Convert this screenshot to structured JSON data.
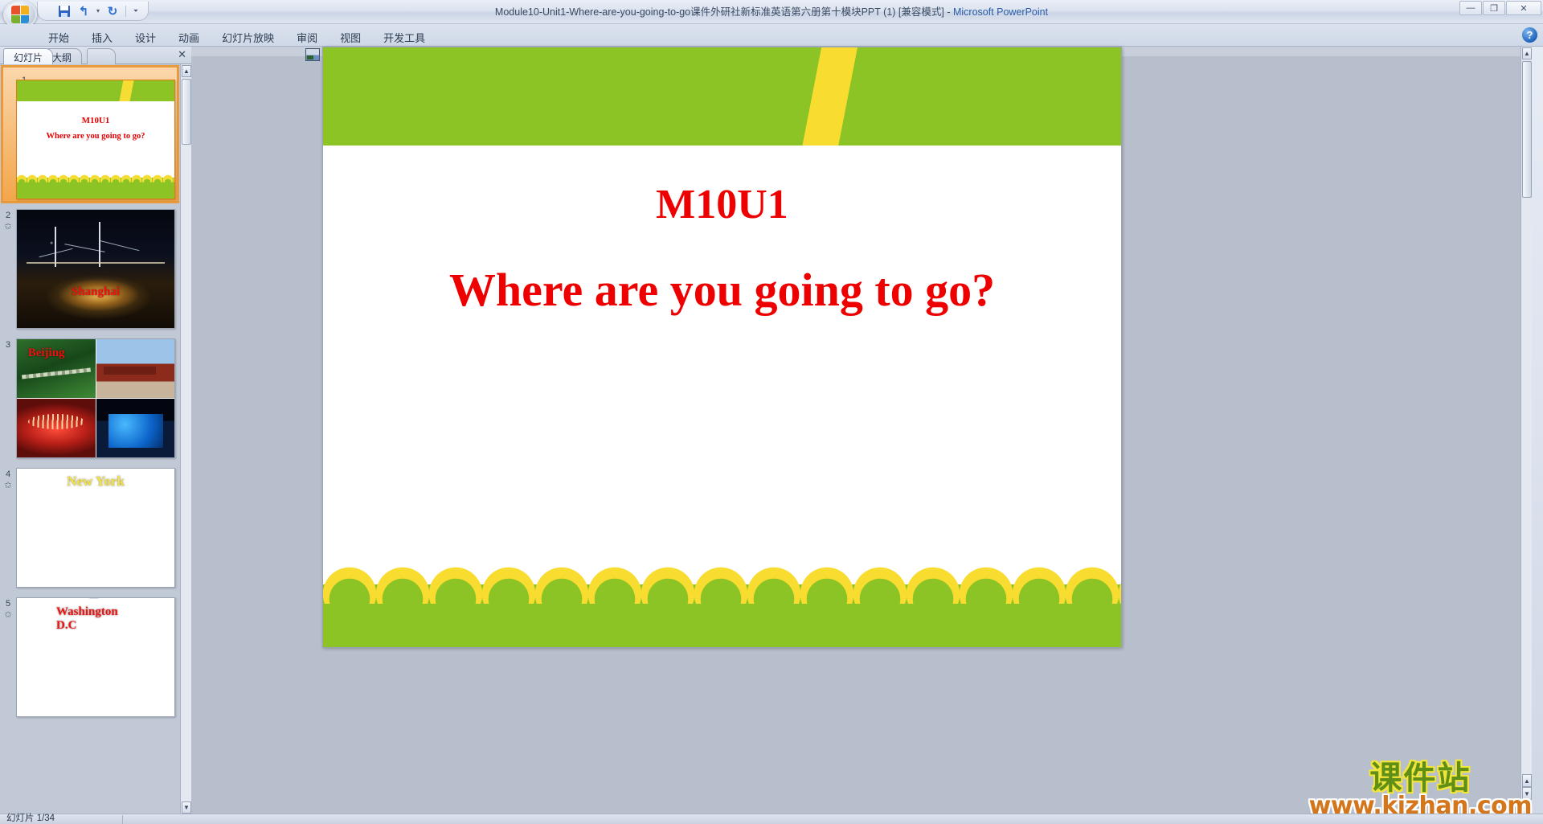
{
  "window": {
    "title": "Module10-Unit1-Where-are-you-going-to-go课件外研社新标准英语第六册第十模块PPT (1) [兼容模式]",
    "separator": " - ",
    "app_name": "Microsoft PowerPoint",
    "minimize_label": "—",
    "restore_label": "❐",
    "close_label": "✕"
  },
  "quick_access": {
    "save_label": "Save",
    "undo_label": "↰",
    "undo_caret": "▾",
    "redo_label": "↻",
    "customize_label": "⏷"
  },
  "office_button": {
    "label": "Office"
  },
  "ribbon": {
    "tabs": [
      {
        "label": "开始"
      },
      {
        "label": "插入"
      },
      {
        "label": "设计"
      },
      {
        "label": "动画"
      },
      {
        "label": "幻灯片放映"
      },
      {
        "label": "审阅"
      },
      {
        "label": "视图"
      },
      {
        "label": "开发工具"
      }
    ],
    "help_label": "?"
  },
  "pane": {
    "tabs": [
      {
        "label": "幻灯片",
        "active": true
      },
      {
        "label": "大纲",
        "active": false
      }
    ],
    "close_label": "✕",
    "scroll_up": "▲",
    "scroll_down": "▼"
  },
  "thumbnails": [
    {
      "number": "1",
      "selected": true,
      "animated": false,
      "kind": "title",
      "title_line1": "M10U1",
      "title_line2": "Where are you going to go?"
    },
    {
      "number": "2",
      "selected": false,
      "animated": true,
      "kind": "photo-shanghai",
      "label": "Shanghai"
    },
    {
      "number": "3",
      "selected": false,
      "animated": false,
      "kind": "photo-beijing-grid",
      "label": "Beijing"
    },
    {
      "number": "4",
      "selected": false,
      "animated": true,
      "kind": "photo-newyork",
      "label": "New York"
    },
    {
      "number": "5",
      "selected": false,
      "animated": true,
      "kind": "photo-washington",
      "label": "Washington D.C"
    }
  ],
  "slide": {
    "title_line1": "M10U1",
    "title_line2": "Where are you going to go?",
    "title_color": "#ee0000",
    "band_color": "#8cc425",
    "stripe_color": "#f8dd30"
  },
  "watermark": {
    "cn_text": "课件站",
    "url_text": "www.kjzhan.com",
    "cn_color": "#5f8f17",
    "cn_outline": "#f3e53c",
    "url_color": "#d4761b"
  },
  "workspace": {
    "scroll_up": "▲",
    "scroll_prev": "▲",
    "scroll_next": "▼",
    "scroll_down": "▼"
  },
  "status": {
    "slide_counter": "幻灯片 1/34"
  }
}
